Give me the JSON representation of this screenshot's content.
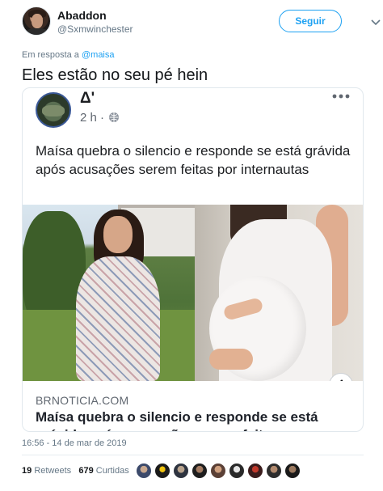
{
  "author": {
    "name": "Abaddon",
    "handle": "@Sxmwinchester",
    "follow_label": "Seguir",
    "menu_icon": "chevron-down-icon"
  },
  "reply": {
    "prefix": "Em resposta a",
    "mention": "@maisa"
  },
  "tweet": {
    "text": "Eles estão no seu pé hein"
  },
  "embedded_post": {
    "page_name": "Δ'",
    "time": "2 h ·",
    "privacy_icon": "globe-icon",
    "menu_icon": "more-dots-icon",
    "text": "Maísa quebra o silencio e responde se está grávida após acusações serem feitas por internautas",
    "info_icon": "info-icon",
    "link_domain": "BRNOTICIA.COM",
    "link_title": "Maísa quebra o silencio e responde se está grávida após acusações serem feitas por internautas"
  },
  "meta": {
    "timestamp": "16:56 - 14 de mar de 2019",
    "retweets_count": "19",
    "retweets_label": "Retweets",
    "likes_count": "679",
    "likes_label": "Curtidas"
  },
  "colors": {
    "accent": "#1da1f2",
    "text": "#14171a",
    "muted": "#657786",
    "border": "#e1e8ed"
  }
}
